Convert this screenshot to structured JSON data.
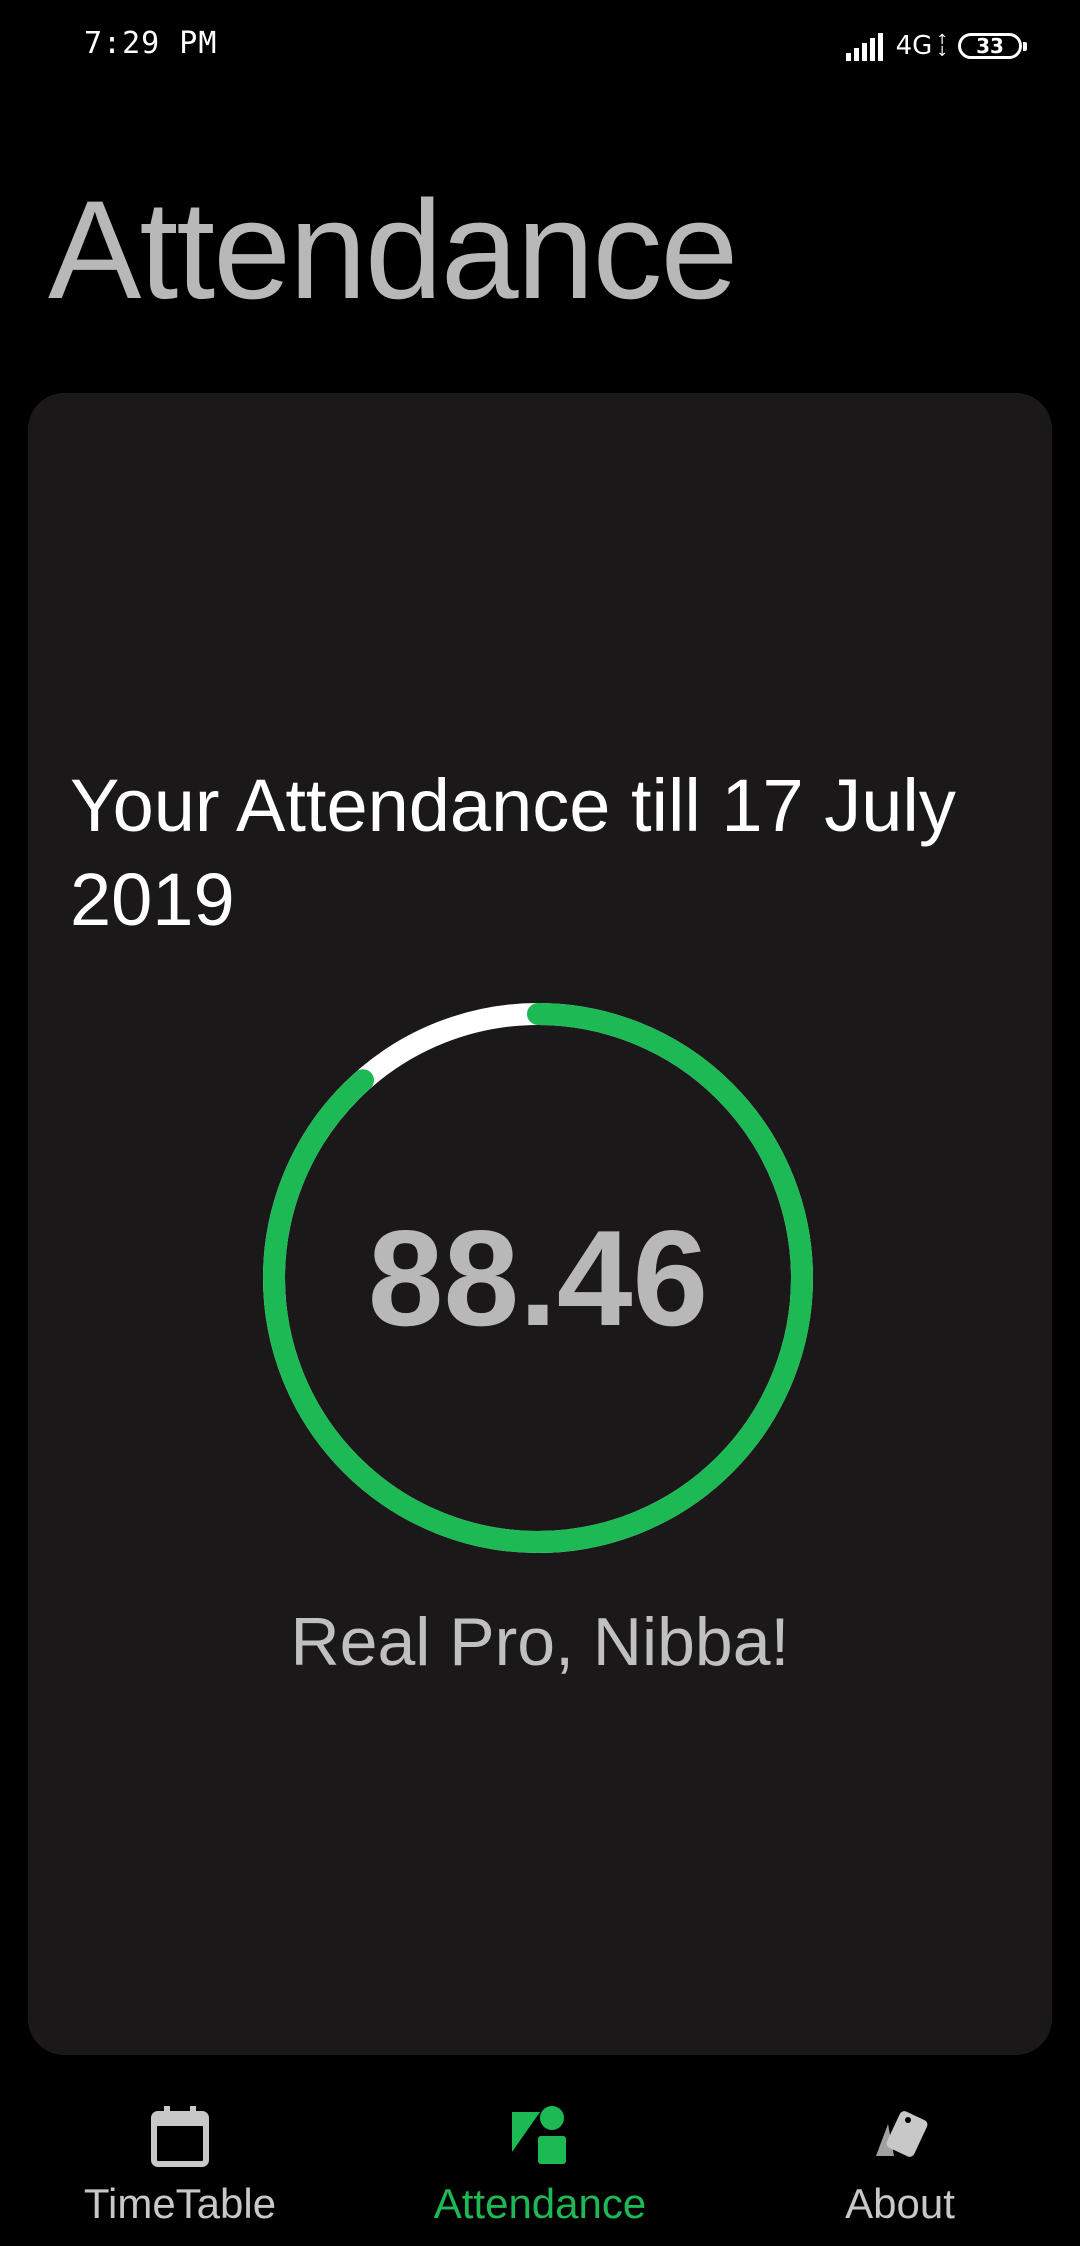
{
  "status_bar": {
    "time": "7:29 PM",
    "network": "4G",
    "battery": "33"
  },
  "page": {
    "title": "Attendance"
  },
  "card": {
    "heading": "Your Attendance till 17 July 2019",
    "percentage_text": "88.46",
    "percentage_value": 88.46,
    "remark": "Real Pro, Nibba!"
  },
  "colors": {
    "accent": "#1db954",
    "ring_track": "#ffffff",
    "card_bg": "#1a1818"
  },
  "bottom_nav": {
    "items": [
      {
        "label": "TimeTable",
        "icon": "calendar-icon",
        "active": false
      },
      {
        "label": "Attendance",
        "icon": "shapes-icon",
        "active": true
      },
      {
        "label": "About",
        "icon": "cards-icon",
        "active": false
      }
    ]
  }
}
